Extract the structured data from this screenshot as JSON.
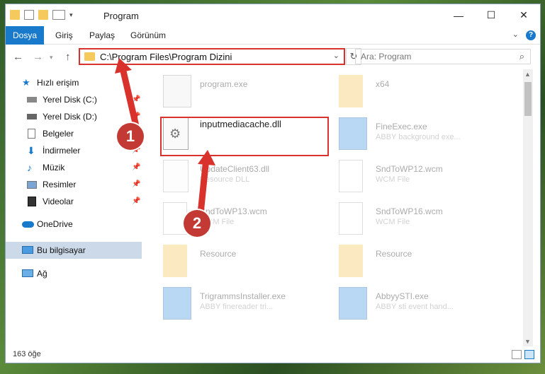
{
  "window": {
    "title": "Program"
  },
  "ribbon": {
    "tabs": [
      "Dosya",
      "Giriş",
      "Paylaş",
      "Görünüm"
    ]
  },
  "address": {
    "path": "C:\\Program Files\\Program Dizini"
  },
  "search": {
    "placeholder": "Ara: Program"
  },
  "sidebar": {
    "items": [
      {
        "label": "Hızlı erişim",
        "icon": "star-icon"
      },
      {
        "label": "Yerel Disk (C:)",
        "icon": "drive-icon"
      },
      {
        "label": "Yerel Disk (D:)",
        "icon": "drive-icon"
      },
      {
        "label": "Belgeler",
        "icon": "documents-icon"
      },
      {
        "label": "İndirmeler",
        "icon": "download-icon"
      },
      {
        "label": "Müzik",
        "icon": "music-icon"
      },
      {
        "label": "Resimler",
        "icon": "pictures-icon"
      },
      {
        "label": "Videolar",
        "icon": "videos-icon"
      },
      {
        "label": "OneDrive",
        "icon": "onedrive-icon"
      },
      {
        "label": "Bu bilgisayar",
        "icon": "computer-icon"
      },
      {
        "label": "Ağ",
        "icon": "network-icon"
      }
    ]
  },
  "files": [
    {
      "name": "program.exe",
      "sub": "",
      "kind": "exe"
    },
    {
      "name": "x64",
      "sub": "",
      "kind": "folder"
    },
    {
      "name": "inputmediacache.dll",
      "sub": "",
      "kind": "dll"
    },
    {
      "name": "FineExec.exe",
      "sub": "ABBY background exe...",
      "kind": "exe"
    },
    {
      "name": "UpdateClient63.dll",
      "sub": "Resource DLL",
      "kind": "dll"
    },
    {
      "name": "SndToWP12.wcm",
      "sub": "WCM File",
      "kind": "doc"
    },
    {
      "name": "SndToWP13.wcm",
      "sub": "WCM File",
      "kind": "doc"
    },
    {
      "name": "SndToWP16.wcm",
      "sub": "WCM File",
      "kind": "doc"
    },
    {
      "name": "Resource",
      "sub": "",
      "kind": "folder"
    },
    {
      "name": "Resource",
      "sub": "",
      "kind": "folder"
    },
    {
      "name": "TrigrammsInstaller.exe",
      "sub": "ABBY finereader tri...",
      "kind": "exe"
    },
    {
      "name": "AbbyySTI.exe",
      "sub": "ABBY sti event hand...",
      "kind": "exe"
    }
  ],
  "status": {
    "count": "163 öğe"
  },
  "annotations": {
    "badge1": "1",
    "badge2": "2"
  },
  "colors": {
    "accent": "#1979ca",
    "highlight": "#d9312c"
  }
}
